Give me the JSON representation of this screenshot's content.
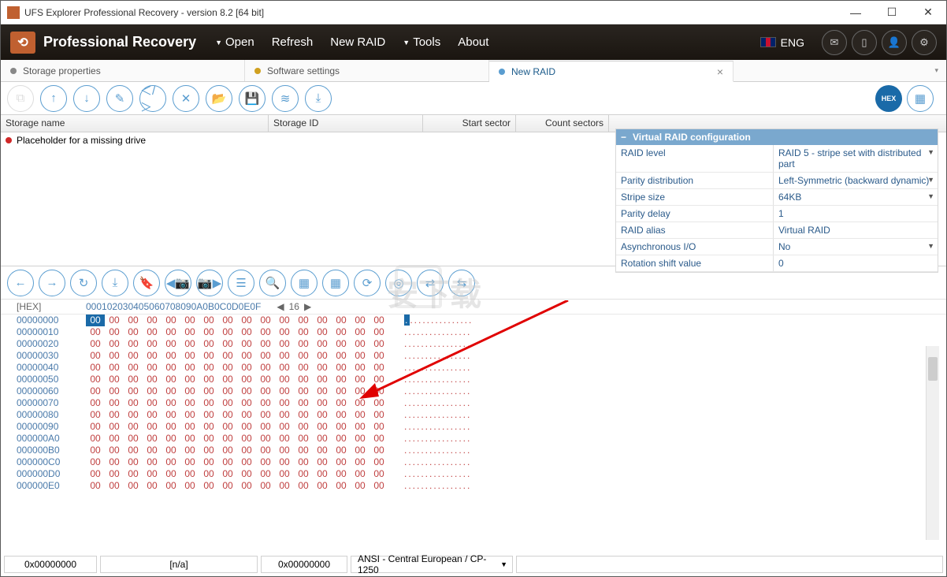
{
  "window": {
    "title": "UFS Explorer Professional Recovery - version 8.2 [64 bit]"
  },
  "brand": "Professional Recovery",
  "menu": {
    "open": "Open",
    "refresh": "Refresh",
    "newraid": "New RAID",
    "tools": "Tools",
    "about": "About"
  },
  "lang": "ENG",
  "tabs": {
    "t1": "Storage properties",
    "t2": "Software settings",
    "t3": "New RAID"
  },
  "grid": {
    "c1": "Storage name",
    "c2": "Storage ID",
    "c3": "Start sector",
    "c4": "Count sectors"
  },
  "storage": {
    "placeholder": "Placeholder for a missing drive"
  },
  "config": {
    "title": "Virtual RAID configuration",
    "rows": [
      {
        "label": "RAID level",
        "value": "RAID 5 - stripe set with distributed part",
        "dd": true
      },
      {
        "label": "Parity distribution",
        "value": "Left-Symmetric (backward dynamic)",
        "dd": true
      },
      {
        "label": "Stripe size",
        "value": "64KB",
        "dd": true
      },
      {
        "label": "Parity delay",
        "value": "1",
        "dd": false
      },
      {
        "label": "RAID alias",
        "value": "Virtual RAID",
        "dd": false
      },
      {
        "label": "Asynchronous I/O",
        "value": "No",
        "dd": true
      },
      {
        "label": "Rotation shift value",
        "value": "0",
        "dd": false
      }
    ]
  },
  "hex": {
    "label": "[HEX]",
    "cols": [
      "00",
      "01",
      "02",
      "03",
      "04",
      "05",
      "06",
      "07",
      "08",
      "09",
      "0A",
      "0B",
      "0C",
      "0D",
      "0E",
      "0F"
    ],
    "count": "16",
    "addrs": [
      "00000000",
      "00000010",
      "00000020",
      "00000030",
      "00000040",
      "00000050",
      "00000060",
      "00000070",
      "00000080",
      "00000090",
      "000000A0",
      "000000B0",
      "000000C0",
      "000000D0",
      "000000E0"
    ],
    "byte": "00",
    "dot": "."
  },
  "status": {
    "offset": "0x00000000",
    "na": "[n/a]",
    "offset2": "0x00000000",
    "enc": "ANSI - Central European / CP-1250"
  }
}
